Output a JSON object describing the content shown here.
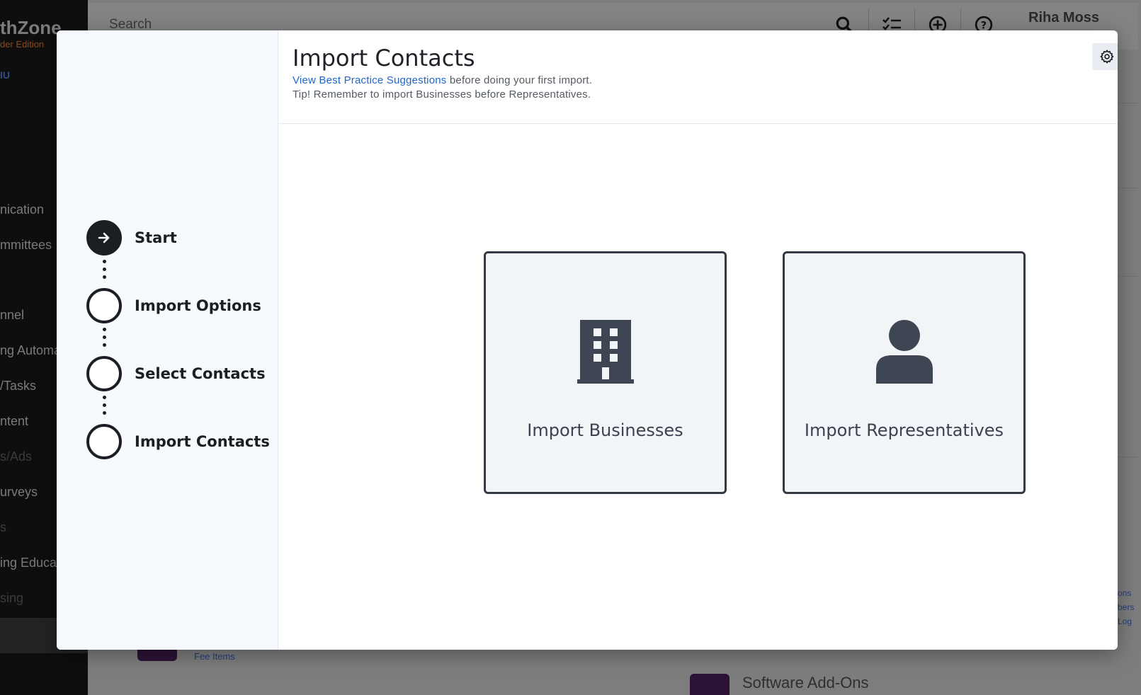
{
  "background": {
    "logo": "thZone",
    "logo_sub": "der Edition",
    "menu_label": "IU",
    "sidebar_items": [
      {
        "label": "nication",
        "dim": false
      },
      {
        "label": "mmittees",
        "dim": false
      },
      {
        "label": "nnel",
        "dim": false
      },
      {
        "label": "ng Automa",
        "dim": false
      },
      {
        "label": "/Tasks",
        "dim": false
      },
      {
        "label": "ntent",
        "dim": false
      },
      {
        "label": "s/Ads",
        "dim": true
      },
      {
        "label": "urveys",
        "dim": false
      },
      {
        "label": "s",
        "dim": true
      },
      {
        "label": "ing Educat",
        "dim": false
      },
      {
        "label": "sing",
        "dim": true
      }
    ],
    "search_placeholder": "Search",
    "user_name": "Riha Moss",
    "links": [
      "ons",
      "bers",
      "Log"
    ],
    "fee_items": "Fee Items",
    "software_addons": "Software Add-Ons"
  },
  "modal": {
    "title": "Import Contacts",
    "best_practice_link": "View Best Practice Suggestions",
    "best_practice_suffix": " before doing your first import.",
    "tip": "Tip! Remember to import Businesses before Representatives.",
    "steps": [
      {
        "label": "Start",
        "active": true
      },
      {
        "label": "Import Options",
        "active": false
      },
      {
        "label": "Select Contacts",
        "active": false
      },
      {
        "label": "Import Contacts",
        "active": false
      }
    ],
    "choices": [
      {
        "label": "Import Businesses",
        "icon": "building-icon"
      },
      {
        "label": "Import Representatives",
        "icon": "person-icon"
      }
    ]
  }
}
